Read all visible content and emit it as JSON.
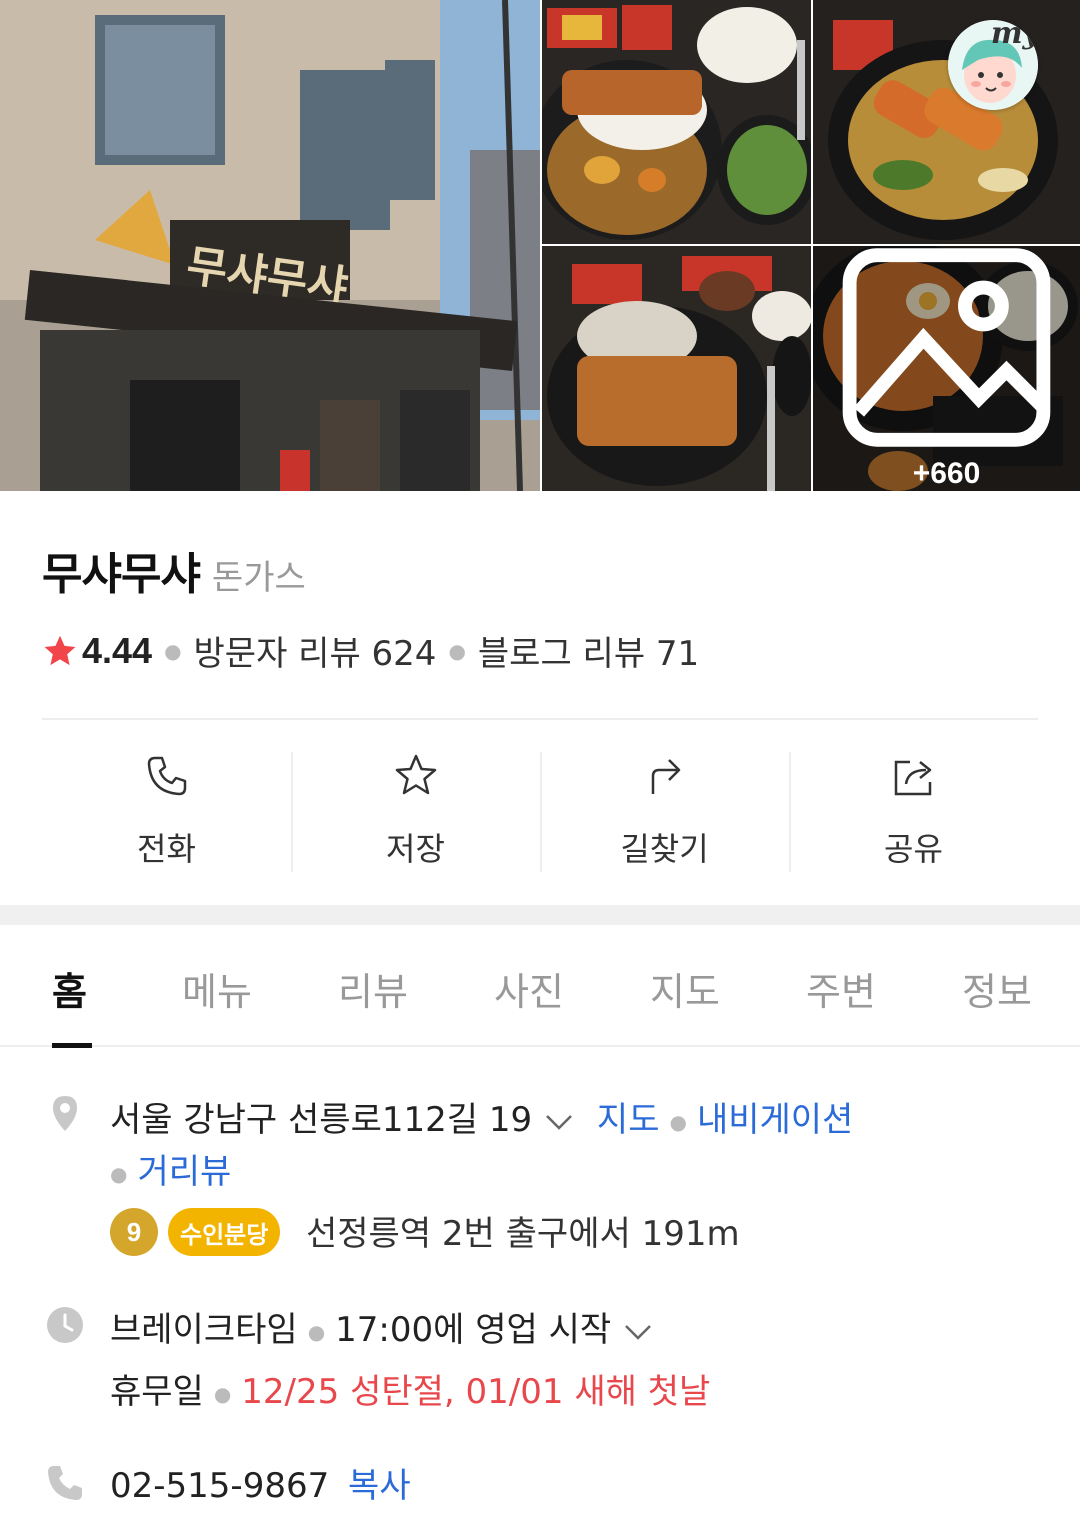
{
  "gallery": {
    "more_count": "+660",
    "my_label": "my"
  },
  "place": {
    "name": "무샤무샤",
    "category": "돈가스",
    "rating": "4.44",
    "visitor_reviews": "방문자 리뷰 624",
    "blog_reviews": "블로그 리뷰 71"
  },
  "actions": [
    {
      "label": "전화",
      "icon": "phone-icon"
    },
    {
      "label": "저장",
      "icon": "star-outline-icon"
    },
    {
      "label": "길찾기",
      "icon": "directions-icon"
    },
    {
      "label": "공유",
      "icon": "share-icon"
    }
  ],
  "tabs": [
    "홈",
    "메뉴",
    "리뷰",
    "사진",
    "지도",
    "주변",
    "정보"
  ],
  "address": {
    "text": "서울 강남구 선릉로112길 19",
    "map_link": "지도",
    "navi_link": "내비게이션",
    "street_view_link": "거리뷰"
  },
  "transit": {
    "line_number": "9",
    "line_name": "수인분당",
    "directions": "선정릉역 2번 출구에서 191m"
  },
  "hours": {
    "status": "브레이크타임",
    "detail": "17:00에 영업 시작",
    "closed_label": "휴무일",
    "closed_days": "12/25 성탄절, 01/01 새해 첫날"
  },
  "phone": {
    "number": "02-515-9867",
    "copy_label": "복사"
  },
  "colors": {
    "accent_blue": "#2b6bd8",
    "holiday_red": "#e8474c",
    "star_red": "#f2454a",
    "line9_gold": "#d4a72c",
    "suin_yellow": "#f3b400"
  }
}
